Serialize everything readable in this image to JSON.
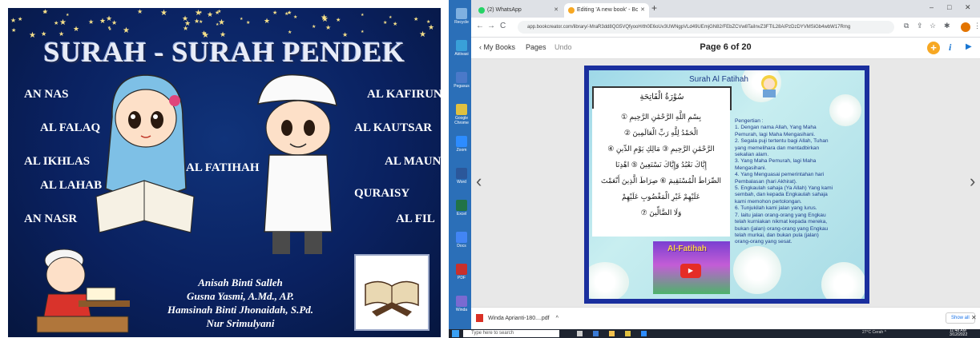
{
  "poster": {
    "title": "SURAH - SURAH PENDEK",
    "surah_left": [
      "AN NAS",
      "AL FALAQ",
      "AL IKHLAS",
      "AL LAHAB",
      "AN NASR"
    ],
    "surah_center": "AL FATIHAH",
    "surah_right": [
      "AL KAFIRUN",
      "AL KAUTSAR",
      "AL MAUN",
      "QURAISY",
      "AL FIL"
    ],
    "authors": [
      "Anisah Binti Salleh",
      "Gusna Yasmi, A.Md., AP.",
      "Hamsinah Binti Jhonaidah, S.Pd.",
      "Nur Srimulyani"
    ]
  },
  "desktop_icons": [
    {
      "label": "Recycle",
      "color": "#7fb0e0"
    },
    {
      "label": "Aktivasi",
      "color": "#39a0d8"
    },
    {
      "label": "Pegasus",
      "color": "#4a79c9"
    },
    {
      "label": "Google Chrome",
      "color": "#e0c040"
    },
    {
      "label": "Zoom",
      "color": "#2d8cff"
    },
    {
      "label": "Word",
      "color": "#2b579a"
    },
    {
      "label": "Excel",
      "color": "#217346"
    },
    {
      "label": "Docs",
      "color": "#4285f4"
    },
    {
      "label": "PDF",
      "color": "#c9302c"
    },
    {
      "label": "Winda",
      "color": "#7a6ad1"
    }
  ],
  "browser": {
    "tabs": [
      {
        "label": "(2) WhatsApp",
        "icon": "whatsapp-icon",
        "color": "#25d366"
      },
      {
        "label": "Editing 'A new book' - Book Crea",
        "icon": "book-creator-icon",
        "color": "#f7a823"
      }
    ],
    "new_tab": "+",
    "window_controls": {
      "minimize": "–",
      "maximize": "□",
      "close": "✕"
    },
    "url": "app.bookcreator.com/library/-MraR3dd8QG5VQfyooH/th0E6oUv3UWNgpVLd49UEmjGN82/FEbZCVw8TaiInvZ3FTlL28A/PzDzDYVMSiGb4wbW17Rmg",
    "nav_icons": {
      "back": "←",
      "forward": "→",
      "reload": "C"
    }
  },
  "bookbar": {
    "back": "‹  My Books",
    "pages": "Pages",
    "undo": "Undo",
    "page_indicator": "Page 6 of 20",
    "add": "+",
    "info": "i",
    "play": "▶"
  },
  "book_page": {
    "title": "Surah Al Fatihah",
    "arabic_heading": "سُوْرَةُ الْفَاتِحَةِ",
    "arabic_lines": [
      "بِسْمِ اللَّهِ الرَّحْمَٰنِ الرَّحِيمِ ①",
      "الْحَمْدُ لِلَّهِ رَبِّ الْعَالَمِينَ ②",
      "الرَّحْمَٰنِ الرَّحِيمِ ③ مَالِكِ يَوْمِ الدِّينِ ④",
      "إِيَّاكَ نَعْبُدُ وَإِيَّاكَ نَسْتَعِينُ ⑤ اهْدِنَا",
      "الصِّرَاطَ الْمُسْتَقِيمَ ⑥ صِرَاطَ الَّذِينَ أَنْعَمْتَ",
      "عَلَيْهِمْ غَيْرِ الْمَغْضُوبِ عَلَيْهِمْ",
      "وَلَا الضَّالِّينَ ⑦"
    ],
    "video_title": "Al-Fatihah",
    "meaning": [
      "Pengertian :",
      "1. Dengan nama Allah, Yang Maha",
      "Pemurah, lagi Maha Mengasihani.",
      "2. Segala puji tertentu bagi Allah, Tuhan",
      "yang memelihara dan mentadbirkan",
      "sekalian alam.",
      "3. Yang Maha Pemurah, lagi Maha",
      "Mengasihani.",
      "4. Yang Menguasai pemerintahan hari",
      "Pembalasan (hari Akhirat).",
      "5. Engkaulah sahaja (Ya Allah) Yang kami",
      "sembah, dan kepada Engkaulah sahaja",
      "kami memohon pertolongan.",
      "6. Tunjukilah kami jalan yang lurus.",
      "7. Iaitu jalan orang-orang yang Engkau",
      "telah kurniakan nikmat kepada mereka,",
      "bukan (jalan) orang-orang yang Engkau",
      "telah murkai, dan bukan pula (jalan)",
      "orang-orang yang sesat."
    ]
  },
  "downloads": {
    "file": "Winda Aprianti-180....pdf",
    "chevron": "^",
    "show_all": "Show all",
    "close": "✕"
  },
  "taskbar": {
    "search_placeholder": "Type here to search",
    "weather": "27°C  Cerah  ^",
    "time": "11:48 AM",
    "date": "3/12/2022"
  }
}
